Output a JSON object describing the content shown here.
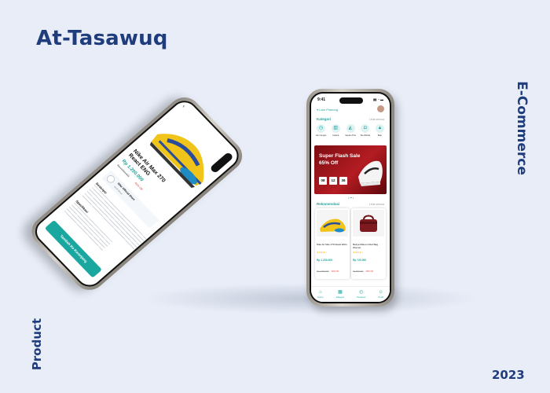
{
  "brand": {
    "title": "At-Tasawuq",
    "category": "E-Commerce",
    "type_label": "Product",
    "year": "2023"
  },
  "colors": {
    "accent": "#1aa7a0",
    "brand_text": "#1f3c7c",
    "background": "#e8edf8",
    "flash_red": "#b31c22"
  },
  "home_screen": {
    "status_time": "9:41",
    "status_icons": "▮▮ ◔ ▬",
    "location_icon": "pin-icon",
    "location_text": "Lam Pineung",
    "categories_label": "Kategori",
    "categories_more": "Lihat semua",
    "categories": [
      {
        "label": "Jam tangan",
        "icon": "watch-icon",
        "glyph": "◷"
      },
      {
        "label": "Celana",
        "icon": "pants-icon",
        "glyph": "▥"
      },
      {
        "label": "Sepatu Pria",
        "icon": "shoe-icon",
        "glyph": "◭"
      },
      {
        "label": "Tas Wanita",
        "icon": "bag-icon",
        "glyph": "◘"
      },
      {
        "label": "Baju",
        "icon": "shirt-icon",
        "glyph": "▲"
      }
    ],
    "flash_sale": {
      "title": "Super Flash Sale 65% Off",
      "timer": [
        "08",
        "12",
        "36"
      ]
    },
    "carousel_dots": "• ━ •",
    "recommend_label": "Rekomendasi",
    "recommend_more": "Lihat semua",
    "products": [
      {
        "name": "Nike Air Max 270 React ENG",
        "stars": "★★★★☆",
        "price": "Rp 1.200.000",
        "old_price": "Rp 2.000.000",
        "discount": "40% Off"
      },
      {
        "name": "Bettya Maroon Red Bag Woman",
        "stars": "★★★★☆",
        "price": "Rp 720.000",
        "old_price": "Rp 900.000",
        "discount": "20% Off"
      }
    ],
    "nav": [
      {
        "label": "Home",
        "icon": "home-icon",
        "glyph": "⌂"
      },
      {
        "label": "Kategori",
        "icon": "category-icon",
        "glyph": "▦"
      },
      {
        "label": "Pesanan",
        "icon": "orders-icon",
        "glyph": "◴"
      },
      {
        "label": "Profil",
        "icon": "profile-icon",
        "glyph": "☺"
      }
    ]
  },
  "detail_screen": {
    "back_glyph": "‹",
    "product_name": "Nike Air Max 270 React ENG",
    "price": "Rp 1.200.000",
    "old_price": "Rp 2.000.000",
    "discount": "40% Off",
    "store_name": "Nike Official Store",
    "store_sub": "Aceh Besar",
    "description_label": "Deskripsi",
    "spec_label": "Spesifikasi",
    "button_label": "Tambah Ke Keranjang"
  }
}
